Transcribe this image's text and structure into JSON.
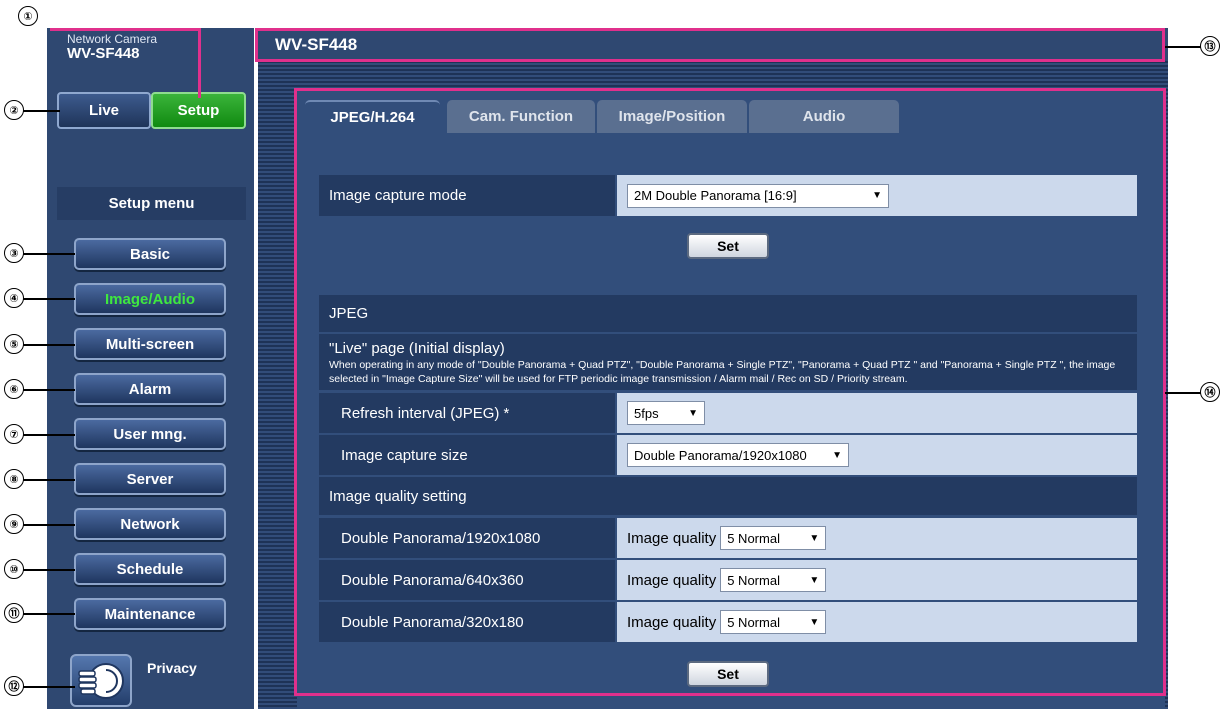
{
  "camera": {
    "caption": "Network Camera",
    "model": "WV-SF448"
  },
  "nav": {
    "live": "Live",
    "setup": "Setup"
  },
  "setup_menu_title": "Setup menu",
  "menu": [
    "Basic",
    "Image/Audio",
    "Multi-screen",
    "Alarm",
    "User mng.",
    "Server",
    "Network",
    "Schedule",
    "Maintenance"
  ],
  "active_menu": "Image/Audio",
  "privacy_label": "Privacy",
  "header_title": "WV-SF448",
  "tabs": [
    "JPEG/H.264",
    "Cam. Function",
    "Image/Position",
    "Audio"
  ],
  "image_capture_mode": {
    "label": "Image capture mode",
    "value": "2M Double Panorama [16:9]"
  },
  "set_button": "Set",
  "jpeg_section": "JPEG",
  "live_page": {
    "title": "\"Live\" page (Initial display)",
    "note": "When operating in any mode of \"Double Panorama + Quad PTZ\", \"Double Panorama + Single PTZ\", \"Panorama + Quad PTZ \" and \"Panorama + Single PTZ \", the image selected in \"Image Capture Size\" will be used for FTP periodic image transmission / Alarm mail / Rec on SD / Priority stream."
  },
  "refresh_interval": {
    "label": "Refresh interval (JPEG) *",
    "value": "5fps"
  },
  "image_capture_size": {
    "label": "Image capture size",
    "value": "Double Panorama/1920x1080"
  },
  "image_quality_setting": "Image quality setting",
  "quality_rows": [
    {
      "label": "Double Panorama/1920x1080",
      "prefix": "Image quality",
      "value": "5 Normal"
    },
    {
      "label": "Double Panorama/640x360",
      "prefix": "Image quality",
      "value": "5 Normal"
    },
    {
      "label": "Double Panorama/320x180",
      "prefix": "Image quality",
      "value": "5 Normal"
    }
  ],
  "callouts": [
    "①",
    "②",
    "③",
    "④",
    "⑤",
    "⑥",
    "⑦",
    "⑧",
    "⑨",
    "⑩",
    "⑪",
    "⑫",
    "⑬",
    "⑭"
  ],
  "colors": {
    "panel": "#2f4871",
    "active_menu_text": "#3fe83f",
    "setup_green": "#109410",
    "annotation": "#e0308c"
  }
}
